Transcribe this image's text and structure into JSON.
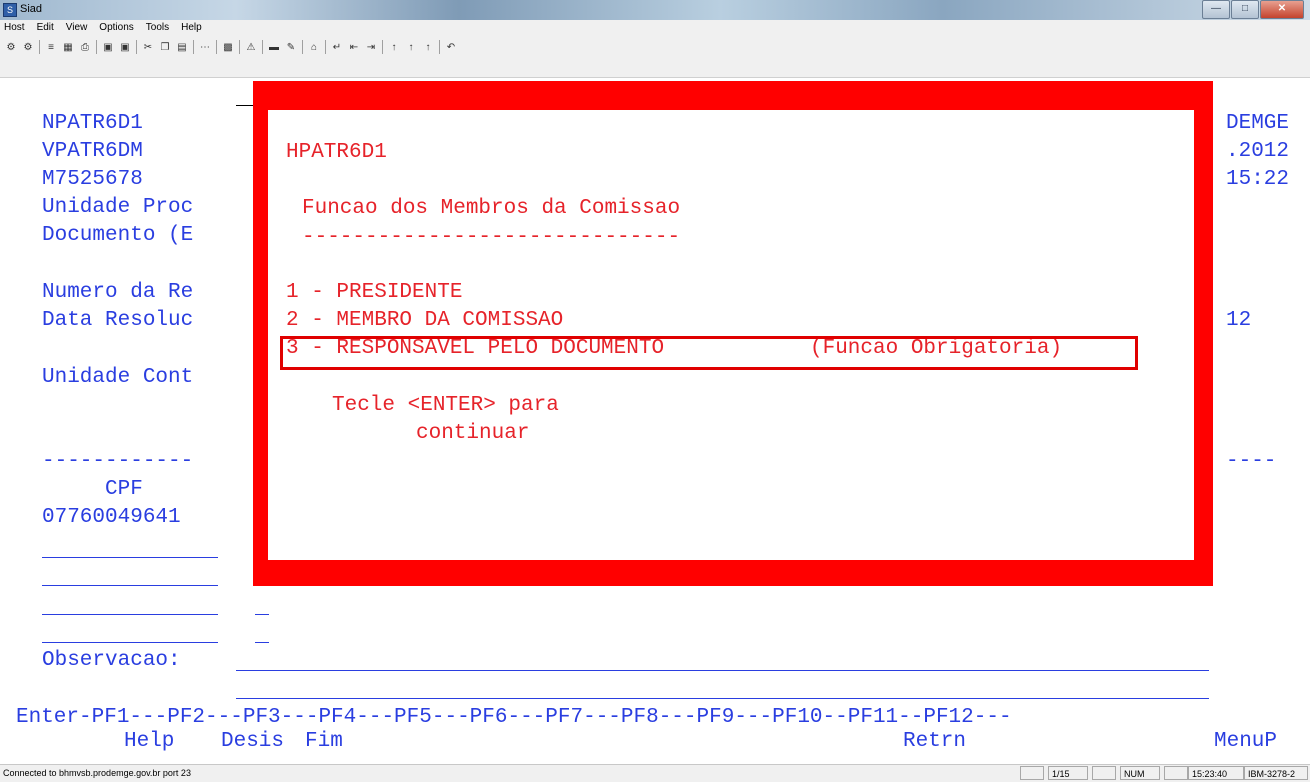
{
  "window": {
    "title": "Siad",
    "icon": "app-icon"
  },
  "menu": [
    "Host",
    "Edit",
    "View",
    "Options",
    "Tools",
    "Help"
  ],
  "toolbar_icons": [
    "session-icon",
    "session2-icon",
    "sep",
    "send-icon",
    "receive-icon",
    "print-icon",
    "sep",
    "macro-icon",
    "macro2-icon",
    "sep",
    "cut-icon",
    "copy-icon",
    "paste-icon",
    "sep",
    "dots-icon",
    "sep",
    "chart-icon",
    "sep",
    "warning-icon",
    "sep",
    "screen-icon",
    "edit-icon",
    "sep",
    "home-icon",
    "sep",
    "enter-icon",
    "tab-back-icon",
    "tab-icon",
    "sep",
    "k1-icon",
    "k2-icon",
    "k3-icon",
    "sep",
    "undo-icon"
  ],
  "screen": {
    "left_lines": [
      "NPATR6D1",
      "VPATR6DM",
      "M7525678",
      "Unidade Proc",
      "Documento (E",
      "Numero da Re",
      "Data Resoluc",
      "Unidade Cont",
      "------------",
      "CPF",
      "07760049641"
    ],
    "right_lines": [
      "DEMGE",
      ".2012",
      "15:22",
      "12",
      "----"
    ],
    "observacao_label": "Observacao:",
    "pf_keys": "Enter-PF1---PF2---PF3---PF4---PF5---PF6---PF7---PF8---PF9---PF10--PF11--PF12---",
    "pf_labels": {
      "help": "Help",
      "desis": "Desis",
      "fim": "Fim",
      "retrn": "Retrn",
      "menup": "MenuP"
    }
  },
  "popup": {
    "id": "HPATR6D1",
    "title": "Funcao dos Membros da Comissao",
    "dashes": "------------------------------",
    "options": [
      "1 - PRESIDENTE",
      "2 - MEMBRO DA COMISSAO",
      "3 - RESPONSAVEL PELO DOCUMENTO"
    ],
    "option3_note": "(Funcao Obrigatoria)",
    "instruction1": "Tecle <ENTER> para",
    "instruction2": "continuar"
  },
  "status": {
    "message": "Connected to bhmvsb.prodemge.gov.br port 23",
    "page": "1/15",
    "num": "NUM",
    "time": "15:23:40",
    "terminal": "IBM-3278-2"
  },
  "colors": {
    "field_blue": "#2a3ee0",
    "popup_red": "#ff0000",
    "text_red": "#e6232a"
  }
}
